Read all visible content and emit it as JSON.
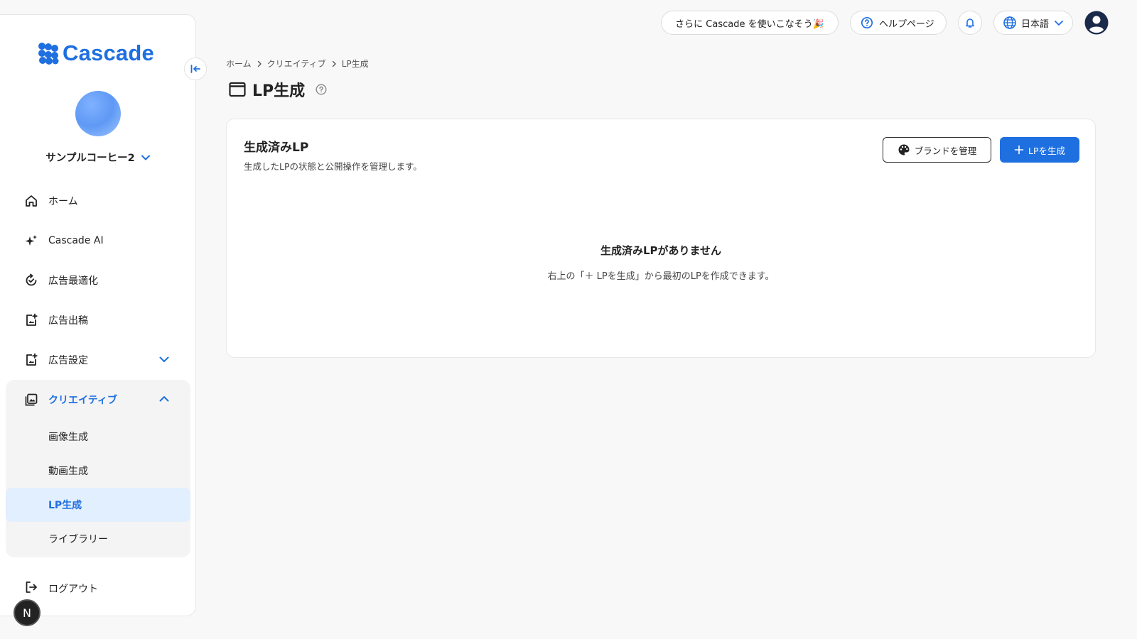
{
  "brand": {
    "name": "Cascade",
    "accent": "#1e6fe0"
  },
  "account": {
    "name": "サンプルコーヒー2"
  },
  "nav": {
    "items": [
      {
        "label": "ホーム"
      },
      {
        "label": "Cascade AI"
      },
      {
        "label": "広告最適化"
      },
      {
        "label": "広告出稿"
      },
      {
        "label": "広告設定"
      }
    ],
    "creative": {
      "label": "クリエイティブ",
      "children": [
        {
          "label": "画像生成"
        },
        {
          "label": "動画生成"
        },
        {
          "label": "LP生成"
        },
        {
          "label": "ライブラリー"
        }
      ]
    },
    "logout": "ログアウト",
    "badge": "N"
  },
  "topbar": {
    "promo": "さらに Cascade を使いこなそう🎉",
    "help": "ヘルプページ",
    "language": "日本語"
  },
  "breadcrumb": [
    "ホーム",
    "クリエイティブ",
    "LP生成"
  ],
  "page": {
    "title": "LP生成"
  },
  "card": {
    "title": "生成済みLP",
    "subtitle": "生成したLPの状態と公開操作を管理します。",
    "manage_brand": "ブランドを管理",
    "generate": "LPを生成",
    "empty_title": "生成済みLPがありません",
    "empty_sub": "右上の「＋ LPを生成」から最初のLPを作成できます。"
  }
}
